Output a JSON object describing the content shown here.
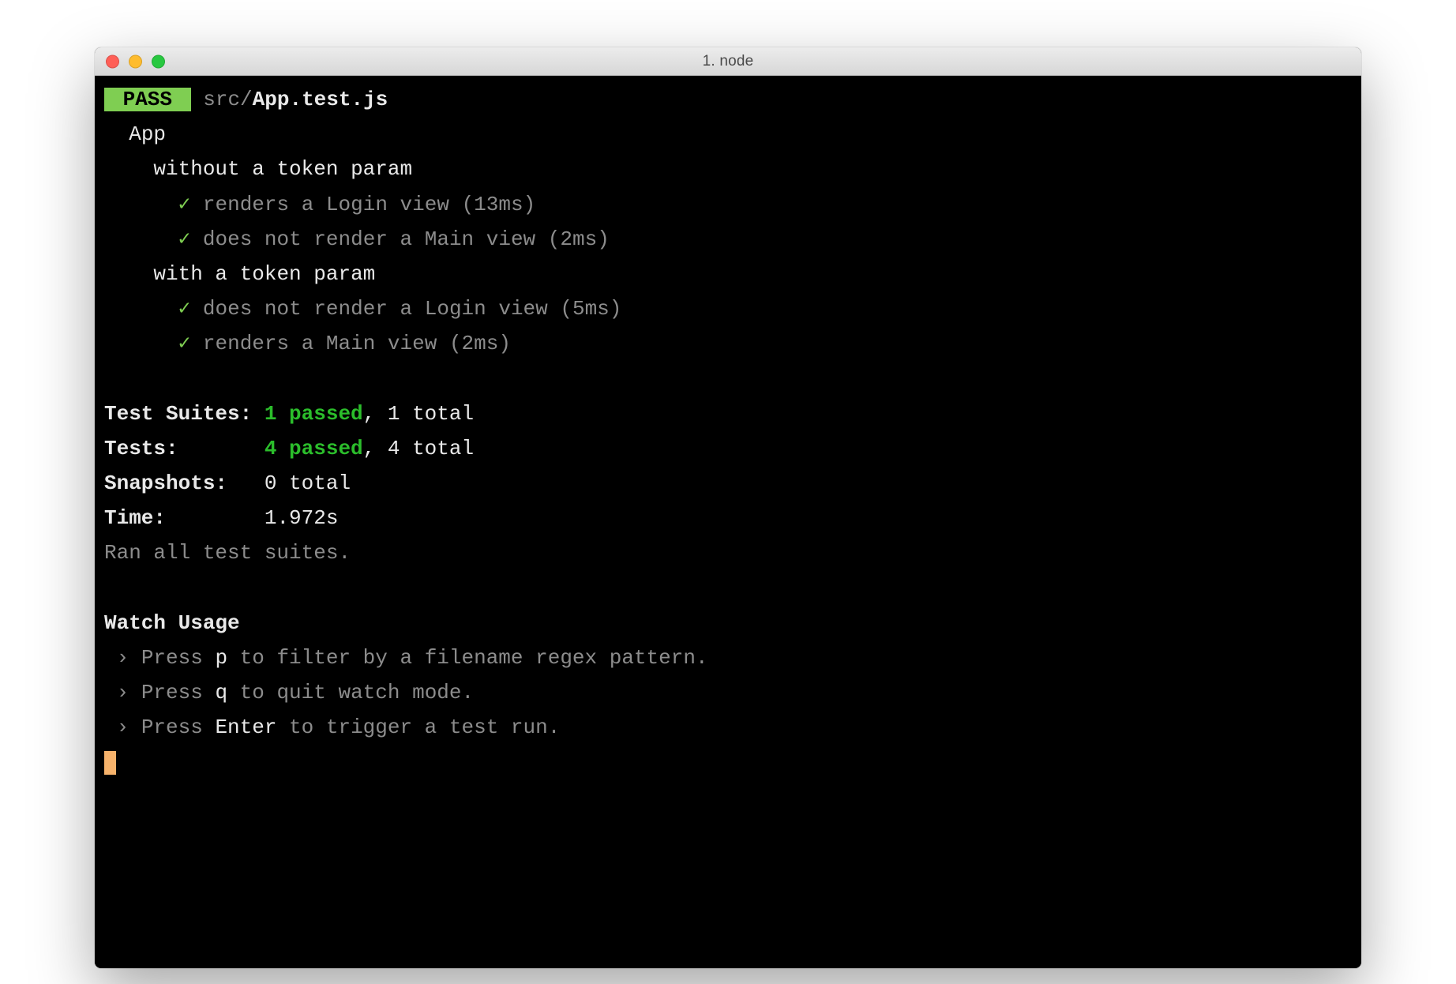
{
  "window": {
    "title": "1. node"
  },
  "test": {
    "status_badge": " PASS ",
    "file_dir": "src/",
    "file_name": "App.test.js",
    "suite": "App",
    "groups": [
      {
        "title": "without a token param",
        "cases": [
          {
            "name": "renders a Login view",
            "time": "(13ms)"
          },
          {
            "name": "does not render a Main view",
            "time": "(2ms)"
          }
        ]
      },
      {
        "title": "with a token param",
        "cases": [
          {
            "name": "does not render a Login view",
            "time": "(5ms)"
          },
          {
            "name": "renders a Main view",
            "time": "(2ms)"
          }
        ]
      }
    ]
  },
  "summary": {
    "test_suites_label": "Test Suites: ",
    "test_suites_pass": "1 passed",
    "test_suites_rest": ", 1 total",
    "tests_label": "Tests:       ",
    "tests_pass": "4 passed",
    "tests_rest": ", 4 total",
    "snapshots_label": "Snapshots:   ",
    "snapshots_value": "0 total",
    "time_label": "Time:        ",
    "time_value": "1.972s",
    "ran_line": "Ran all test suites."
  },
  "watch": {
    "header": "Watch Usage",
    "items": [
      {
        "prefix": " › ",
        "press": "Press ",
        "key": "p",
        "rest": " to filter by a filename regex pattern."
      },
      {
        "prefix": " › ",
        "press": "Press ",
        "key": "q",
        "rest": " to quit watch mode."
      },
      {
        "prefix": " › ",
        "press": "Press ",
        "key": "Enter",
        "rest": " to trigger a test run."
      }
    ]
  },
  "glyph": {
    "check": "✓"
  }
}
